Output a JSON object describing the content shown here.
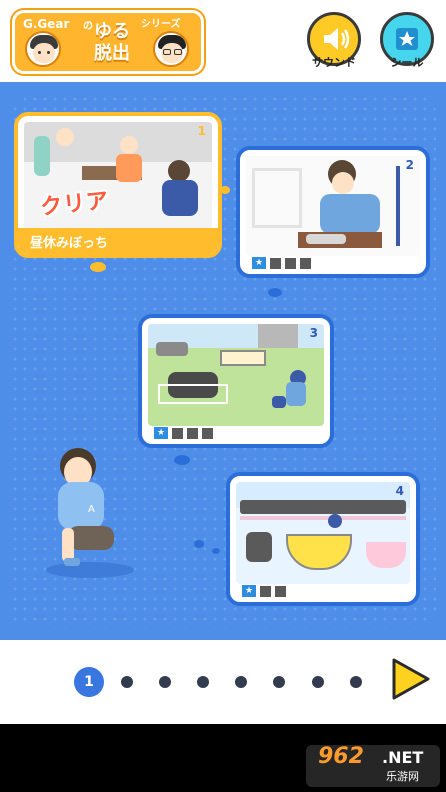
{
  "header": {
    "logo_left": "G.Gear",
    "logo_no": "の",
    "logo_title": "ゆる脱出",
    "logo_series": "シリーズ",
    "sound_label": "サウンド",
    "seal_label": "シール"
  },
  "levels": [
    {
      "number": "1",
      "title": "昼休みぼっち",
      "status": "クリア",
      "cleared": true
    },
    {
      "number": "2",
      "cleared": false
    },
    {
      "number": "3",
      "cleared": false
    },
    {
      "number": "4",
      "cleared": false
    }
  ],
  "pagination": {
    "current": "1",
    "total_pages": 8
  },
  "watermark": {
    "brand": "962",
    "suffix": ".NET",
    "sub": "乐游网"
  },
  "colors": {
    "board_blue": "#4f8ee8",
    "card_border": "#2c6ed9",
    "accent_orange": "#ffbd2e",
    "clear_red": "#ff5a3c",
    "next_yellow": "#ffd21f"
  }
}
